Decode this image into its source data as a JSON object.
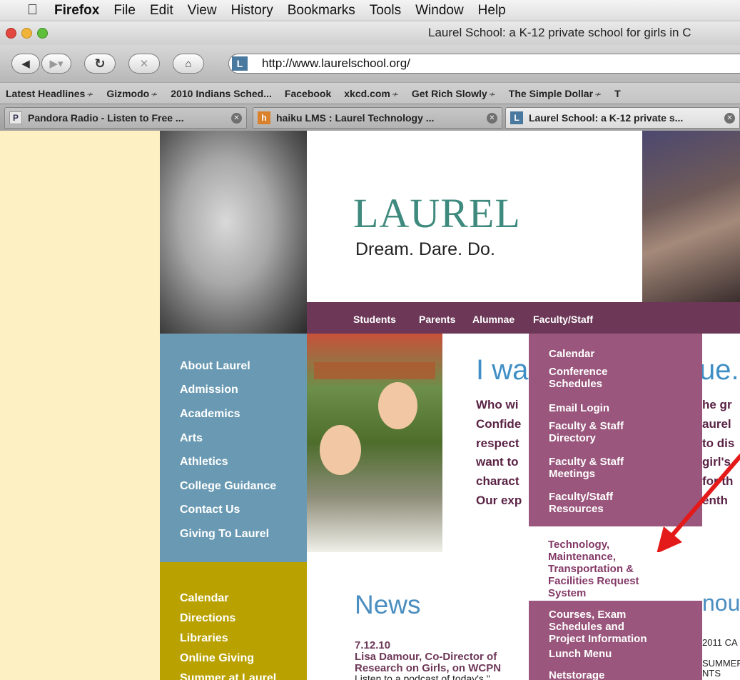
{
  "menubar": {
    "app": "Firefox",
    "items": [
      "File",
      "Edit",
      "View",
      "History",
      "Bookmarks",
      "Tools",
      "Window",
      "Help"
    ]
  },
  "window": {
    "title": "Laurel School: a K-12 private school for girls in C"
  },
  "toolbar": {
    "url": "http://www.laurelschool.org/",
    "site_icon_letter": "L"
  },
  "bookmarks": [
    {
      "label": "Latest Headlines",
      "rss": true
    },
    {
      "label": "Gizmodo",
      "rss": true
    },
    {
      "label": "2010 Indians Sched...",
      "rss": false
    },
    {
      "label": "Facebook",
      "rss": false
    },
    {
      "label": "xkcd.com",
      "rss": true
    },
    {
      "label": "Get Rich Slowly",
      "rss": true
    },
    {
      "label": "The Simple Dollar",
      "rss": true
    },
    {
      "label": "T",
      "rss": false
    }
  ],
  "rss_glyph": "≁",
  "tabs": [
    {
      "label": "Pandora Radio - Listen to Free ...",
      "favicon": "P"
    },
    {
      "label": "haiku LMS : Laurel Technology ...",
      "favicon": "h"
    },
    {
      "label": "Laurel School: a K-12 private s...",
      "favicon": "L"
    }
  ],
  "site": {
    "logo": "LAUREL",
    "tagline": "Dream. Dare. Do.",
    "top_nav": [
      "Students",
      "Parents",
      "Alumnae",
      "Faculty/Staff"
    ],
    "left_nav": [
      "About Laurel",
      "Admission",
      "Academics",
      "Arts",
      "Athletics",
      "College Guidance",
      "Contact Us",
      "Giving To Laurel"
    ],
    "utility_nav": [
      "Calendar",
      "Directions",
      "Libraries",
      "Online Giving",
      "Summer at Laurel"
    ],
    "headline_left": "I wa",
    "headline_right": "ue.",
    "body_left": [
      "Who wi",
      "Confide",
      "respect",
      "want to",
      "charact",
      "Our exp"
    ],
    "body_right": [
      "he gr",
      "aurel",
      "to dis",
      "girl's",
      "for th",
      "enth"
    ],
    "news_heading": "News",
    "news_date": "7.12.10",
    "news_title_1": "Lisa Damour, Co-Director of",
    "news_title_2": "Research on Girls, on WCPN",
    "news_desc": "Listen to a podcast of today's \"",
    "announce_heading": "nounc",
    "announce_lines": [
      "2011 CA",
      "SUMMER",
      "NTS"
    ]
  },
  "dropdown": {
    "items": [
      {
        "label": "Calendar",
        "highlight": false
      },
      {
        "label": "Conference\nSchedules",
        "highlight": false
      },
      {
        "label": "Email Login",
        "highlight": false
      },
      {
        "label": "Faculty & Staff\nDirectory",
        "highlight": false
      },
      {
        "label": "Faculty & Staff\nMeetings",
        "highlight": false
      },
      {
        "label": "Faculty/Staff\nResources",
        "highlight": false
      },
      {
        "label": "Technology,\nMaintenance,\nTransportation &\nFacilities Request\nSystem",
        "highlight": true
      },
      {
        "label": "Courses, Exam\nSchedules and\nProject Information",
        "highlight": false
      },
      {
        "label": "Lunch Menu",
        "highlight": false
      },
      {
        "label": "Netstorage",
        "highlight": false
      }
    ]
  },
  "colors": {
    "brand_teal": "#3f8a7e",
    "nav_purple": "#6d3858",
    "dropdown_purple": "#9a567c",
    "left_nav_blue": "#6a9ab3",
    "utility_olive": "#b9a200",
    "annotation_arrow": "#e41a1a"
  }
}
